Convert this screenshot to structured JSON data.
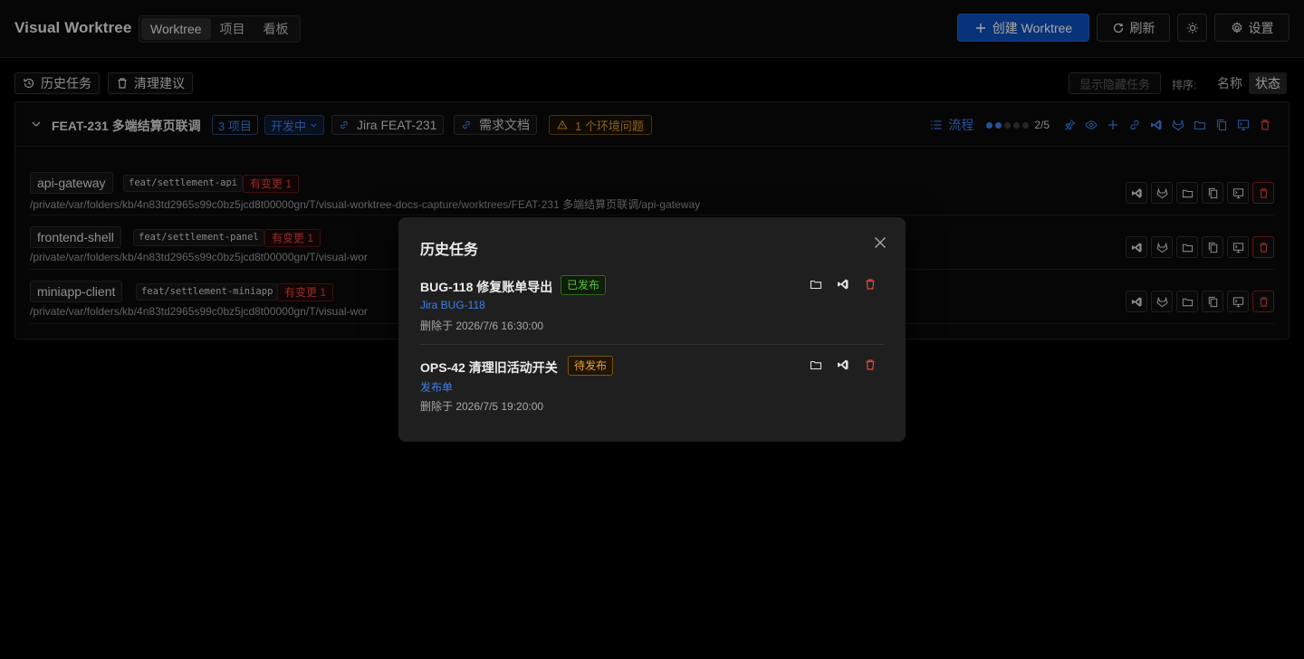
{
  "app": {
    "title": "Visual Worktree",
    "view_tabs": [
      {
        "label": "Worktree",
        "active": true
      },
      {
        "label": "项目",
        "active": false
      },
      {
        "label": "看板",
        "active": false
      }
    ],
    "create_label": "创建 Worktree",
    "refresh_label": "刷新",
    "settings_label": "设置"
  },
  "toolbar": {
    "history_label": "历史任务",
    "cleanup_label": "清理建议",
    "show_hidden_label": "显示隐藏任务",
    "sort_label": "排序:",
    "sort_options": [
      {
        "label": "名称",
        "active": false
      },
      {
        "label": "状态",
        "active": true
      }
    ]
  },
  "task": {
    "title": "FEAT-231 多端结算页联调",
    "project_count": "3 项目",
    "status": "开发中",
    "jira_link": "Jira FEAT-231",
    "doc_link": "需求文档",
    "env_issue": "1 个环境问题",
    "flow_label": "流程",
    "progress": {
      "done": 2,
      "total": 5,
      "text": "2/5"
    },
    "repos": [
      {
        "name": "api-gateway",
        "branch": "feat/settlement-api",
        "changes": "有变更 1",
        "path": "/private/var/folders/kb/4n83td2965s99c0bz5jcd8t00000gn/T/visual-worktree-docs-capture/worktrees/FEAT-231 多端结算页联调/api-gateway"
      },
      {
        "name": "frontend-shell",
        "branch": "feat/settlement-panel",
        "changes": "有变更 1",
        "path": "/private/var/folders/kb/4n83td2965s99c0bz5jcd8t00000gn/T/visual-wor"
      },
      {
        "name": "miniapp-client",
        "branch": "feat/settlement-miniapp",
        "changes": "有变更 1",
        "path": "/private/var/folders/kb/4n83td2965s99c0bz5jcd8t00000gn/T/visual-wor"
      }
    ]
  },
  "history_modal": {
    "title": "历史任务",
    "items": [
      {
        "title": "BUG-118 修复账单导出",
        "badge": "已发布",
        "badge_type": "ok",
        "link": "Jira BUG-118",
        "deleted_at": "删除于 2026/7/6 16:30:00"
      },
      {
        "title": "OPS-42 清理旧活动开关",
        "badge": "待发布",
        "badge_type": "pending",
        "link": "发布单",
        "deleted_at": "删除于 2026/7/5 19:20:00"
      }
    ]
  },
  "colors": {
    "accent": "#3d7ee8",
    "primary_button": "#0f4fb8",
    "danger": "#e0473f",
    "warning": "#d9962a",
    "success": "#56c23a"
  }
}
